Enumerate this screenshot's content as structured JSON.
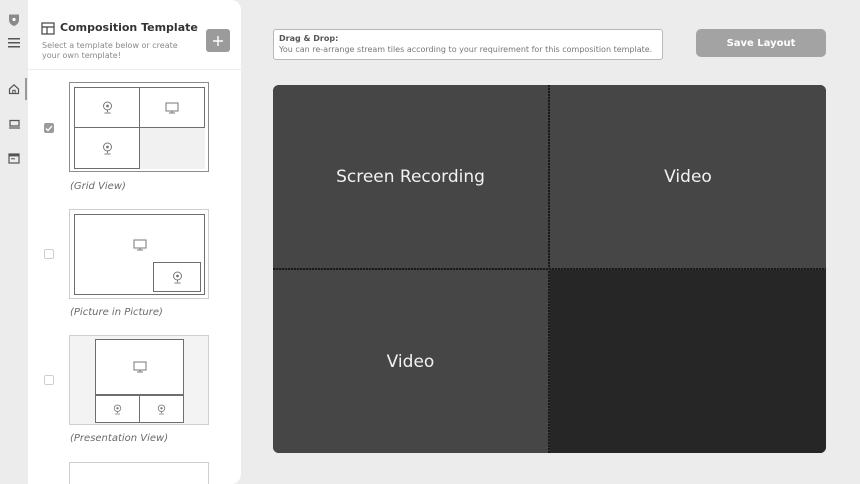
{
  "sidebar": {
    "icons": [
      "shield-icon",
      "menu-icon",
      "home-icon",
      "recorder-icon",
      "window-icon"
    ]
  },
  "panel": {
    "title": "Composition Template",
    "subtitle": "Select a template below or create your own template!",
    "add_icon": "plus-icon",
    "templates": [
      {
        "label": "(Grid View)",
        "selected": true
      },
      {
        "label": "(Picture in Picture)",
        "selected": false
      },
      {
        "label": "(Presentation View)",
        "selected": false
      }
    ]
  },
  "hint": {
    "title": "Drag & Drop:",
    "text": "You can re-arrange stream tiles according to your requirement for this composition template."
  },
  "toolbar": {
    "save_label": "Save Layout"
  },
  "stage": {
    "tiles": [
      {
        "label": "Screen Recording"
      },
      {
        "label": "Video"
      },
      {
        "label": "Video"
      },
      {
        "label": ""
      }
    ]
  },
  "colors": {
    "accent": "#9b9b9b",
    "tile": "#464646",
    "stage_bg": "#262626"
  }
}
